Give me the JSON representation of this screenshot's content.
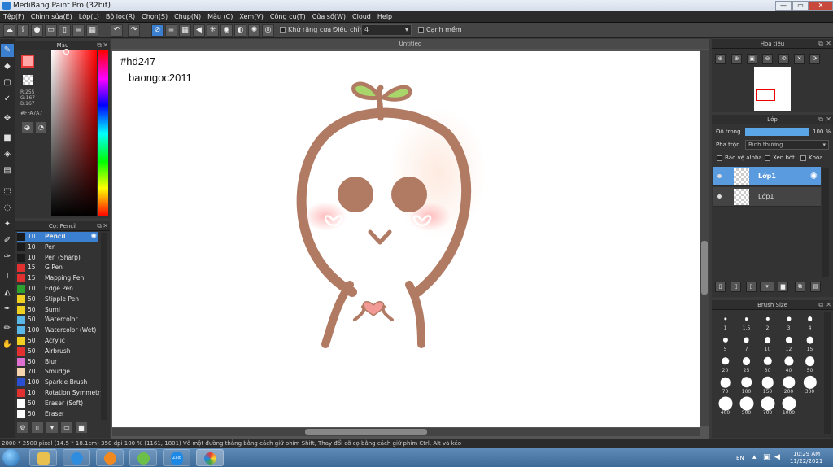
{
  "window": {
    "title": "MediBang Paint Pro (32bit)",
    "minimize": "—",
    "maximize": "▭",
    "close": "✕"
  },
  "menu": [
    "Tệp(F)",
    "Chỉnh sửa(E)",
    "Lớp(L)",
    "Bộ lọc(R)",
    "Chọn(S)",
    "Chụp(N)",
    "Màu (C)",
    "Xem(V)",
    "Công cụ(T)",
    "Cửa sổ(W)",
    "Cloud",
    "Help"
  ],
  "toolbar": {
    "antialias_label": "Khử răng cưa",
    "adjust_label": "Điều chỉnh",
    "adjust_value": "4",
    "snap_label": "Cạnh mềm"
  },
  "color_panel": {
    "title": "Màu",
    "r": "R:255",
    "g": "G:167",
    "b": "B:167",
    "hex": "#FFA7A7",
    "fg_color": "#FFA7A7"
  },
  "brush_panel": {
    "title": "Cọ: Pencil",
    "items": [
      {
        "size": "10",
        "name": "Pencil",
        "color": "#1a1a1a"
      },
      {
        "size": "10",
        "name": "Pen",
        "color": "#1a1a1a"
      },
      {
        "size": "10",
        "name": "Pen (Sharp)",
        "color": "#1a1a1a"
      },
      {
        "size": "15",
        "name": "G Pen",
        "color": "#e03030"
      },
      {
        "size": "15",
        "name": "Mapping Pen",
        "color": "#e03030"
      },
      {
        "size": "10",
        "name": "Edge Pen",
        "color": "#2ea02e"
      },
      {
        "size": "50",
        "name": "Stipple Pen",
        "color": "#f0d020"
      },
      {
        "size": "50",
        "name": "Sumi",
        "color": "#f0d020"
      },
      {
        "size": "50",
        "name": "Watercolor",
        "color": "#5ab8e8"
      },
      {
        "size": "100",
        "name": "Watercolor (Wet)",
        "color": "#5ab8e8"
      },
      {
        "size": "50",
        "name": "Acrylic",
        "color": "#f0d020"
      },
      {
        "size": "50",
        "name": "Airbrush",
        "color": "#e03030"
      },
      {
        "size": "50",
        "name": "Blur",
        "color": "#e070d0"
      },
      {
        "size": "70",
        "name": "Smudge",
        "color": "#f5d5b0"
      },
      {
        "size": "100",
        "name": "Sparkle Brush",
        "color": "#2a4fd0"
      },
      {
        "size": "10",
        "name": "Rotation Symmetry",
        "color": "#e03030"
      },
      {
        "size": "50",
        "name": "Eraser (Soft)",
        "color": "#ffffff"
      },
      {
        "size": "50",
        "name": "Eraser",
        "color": "#ffffff"
      }
    ]
  },
  "canvas": {
    "tab_title": "Untitled",
    "text_line1": "#hd247",
    "text_line2": "baongoc2011"
  },
  "navigator": {
    "title": "Hoa tiêu"
  },
  "layer_panel": {
    "title": "Lớp",
    "opacity_label": "Độ trong",
    "opacity_value": "100 %",
    "opacity_fraction": 1.0,
    "blend_label": "Pha trộn",
    "blend_value": "Bình thường",
    "protect_alpha": "Bảo vệ alpha",
    "clipping": "Xén bớt",
    "lock": "Khóa",
    "layers": [
      "Lớp1",
      "Lớp1"
    ]
  },
  "brush_size_panel": {
    "title": "Brush Size",
    "sizes": [
      "1",
      "1.5",
      "2",
      "3",
      "4",
      "5",
      "7",
      "10",
      "12",
      "15",
      "20",
      "25",
      "30",
      "40",
      "50",
      "70",
      "100",
      "150",
      "200",
      "300",
      "400",
      "500",
      "700",
      "1000"
    ]
  },
  "status": {
    "size": "2000 * 2500 pixel",
    "cm": "(14.5 * 18.1cm)",
    "dpi": "350 dpi",
    "zoom": "100 %",
    "coords": "(1161, 1801)",
    "hint": "Vẽ một đường thẳng bằng cách giữ phím Shift, Thay đổi cỡ cọ bằng cách giữ phím Ctrl, Alt và kéo"
  },
  "taskbar": {
    "lang": "EN",
    "time": "10:29 AM",
    "date": "11/22/2021",
    "zalo": "Zalo"
  }
}
